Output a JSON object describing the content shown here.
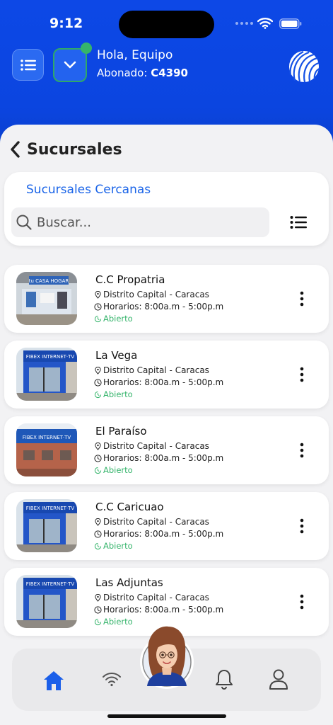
{
  "status_bar": {
    "time": "9:12"
  },
  "header": {
    "greeting": "Hola, Equipo",
    "subscriber_label": "Abonado:",
    "subscriber_id": "C4390"
  },
  "page": {
    "title": "Sucursales",
    "nearby_link": "Sucursales Cercanas",
    "search_placeholder": "Buscar..."
  },
  "branches": [
    {
      "name": "C.C Propatria",
      "location": "Distrito Capital - Caracas",
      "hours": "Horarios: 8:00a.m - 5:00p.m",
      "status": "Abierto"
    },
    {
      "name": "La Vega",
      "location": "Distrito Capital - Caracas",
      "hours": "Horarios: 8:00a.m - 5:00p.m",
      "status": "Abierto"
    },
    {
      "name": "El Paraíso",
      "location": "Distrito Capital - Caracas",
      "hours": "Horarios: 8:00a.m - 5:00p.m",
      "status": "Abierto"
    },
    {
      "name": "C.C Caricuao",
      "location": "Distrito Capital - Caracas",
      "hours": "Horarios: 8:00a.m - 5:00p.m",
      "status": "Abierto"
    },
    {
      "name": "Las Adjuntas",
      "location": "Distrito Capital - Caracas",
      "hours": "Horarios: 8:00a.m - 5:00p.m",
      "status": "Abierto"
    }
  ],
  "photo_signs": {
    "propatria": "tu CASA HOGAR",
    "fibex": "FIBEX INTERNET·TV"
  },
  "icons": {
    "menu": "list-icon",
    "dropdown": "chevron-down-icon",
    "logo": "globe-logo",
    "back": "chevron-left-icon",
    "search": "search-icon",
    "list_view": "list-icon",
    "location": "map-pin-icon",
    "clock": "clock-icon",
    "more": "more-vertical-icon",
    "home": "home-icon",
    "wifi": "wifi-icon",
    "bell": "bell-icon",
    "user": "user-icon"
  },
  "colors": {
    "brand_blue": "#0d48e6",
    "link_blue": "#1a64e8",
    "status_green": "#35b46b"
  }
}
